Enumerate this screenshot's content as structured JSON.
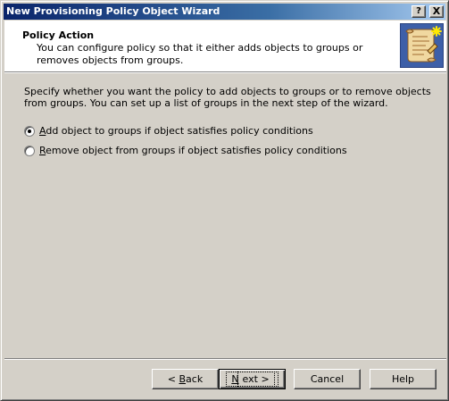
{
  "window": {
    "title": "New Provisioning Policy Object Wizard",
    "help_button": "?",
    "close_button": "X"
  },
  "header": {
    "title": "Policy Action",
    "description": "You can configure policy so that it either adds objects to groups or removes objects from groups."
  },
  "body": {
    "instruction": "Specify whether you want the policy to add objects to groups or to remove objects from groups. You can set up a list of groups in the next step of the wizard.",
    "options": [
      {
        "label": "Add object to groups if object satisfies policy conditions",
        "mnemonic": "A",
        "rest": "dd object to groups if object satisfies policy conditions",
        "selected": true
      },
      {
        "label": "Remove object from groups if object satisfies policy conditions",
        "mnemonic": "R",
        "rest": "emove object from groups if object satisfies policy conditions",
        "selected": false
      }
    ]
  },
  "buttons": {
    "back": {
      "pre": "< ",
      "mnemonic": "B",
      "post": "ack"
    },
    "next": {
      "pre": "",
      "mnemonic": "N",
      "post": "ext >"
    },
    "cancel": "Cancel",
    "help": "Help"
  },
  "colors": {
    "titlebar_start": "#0a246a",
    "titlebar_end": "#a6caf0",
    "face": "#d4d0c8"
  },
  "icons": {
    "header": "scroll-policy-icon"
  }
}
